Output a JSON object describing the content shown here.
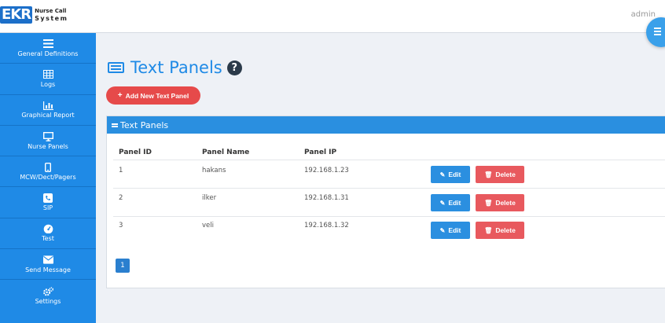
{
  "header": {
    "logo_mark": "EKR",
    "logo_line1": "Nurse Call",
    "logo_line2": "System",
    "user": "admin"
  },
  "sidebar": {
    "items": [
      {
        "label": "General Definitions",
        "icon": "list-icon"
      },
      {
        "label": "Logs",
        "icon": "table-icon"
      },
      {
        "label": "Graphical Report",
        "icon": "bar-chart-icon"
      },
      {
        "label": "Nurse Panels",
        "icon": "monitor-icon"
      },
      {
        "label": "MCW/Dect/Pagers",
        "icon": "mobile-icon"
      },
      {
        "label": "SIP",
        "icon": "phone-icon"
      },
      {
        "label": "Test",
        "icon": "tachometer-icon"
      },
      {
        "label": "Send Message",
        "icon": "envelope-icon"
      },
      {
        "label": "Settings",
        "icon": "gears-icon"
      }
    ]
  },
  "main": {
    "title": "Text Panels",
    "add_button": "Add New Text Panel",
    "panel_title": "Text Panels",
    "columns": [
      "Panel ID",
      "Panel Name",
      "Panel IP"
    ],
    "rows": [
      {
        "id": "1",
        "name": "hakans",
        "ip": "192.168.1.23"
      },
      {
        "id": "2",
        "name": "ilker",
        "ip": "192.168.1.31"
      },
      {
        "id": "3",
        "name": "veli",
        "ip": "192.168.1.32"
      }
    ],
    "edit_label": "Edit",
    "delete_label": "Delete",
    "current_page": "1"
  },
  "colors": {
    "sidebar": "#1f8ae6",
    "accent": "#2a8fe0",
    "danger": "#e64a4a"
  }
}
